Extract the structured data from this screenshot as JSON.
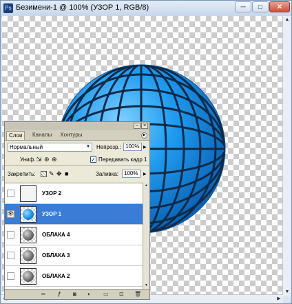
{
  "window": {
    "app_icon": "Ps",
    "title": "Безимени-1 @ 100% (УЗОР 1, RGB/8)",
    "minimize": "─",
    "maximize": "□",
    "close": "✕"
  },
  "canvas": {
    "image": "blue-tiled-sphere"
  },
  "layers_panel": {
    "tabs": [
      "Слои",
      "Каналы",
      "Контуры"
    ],
    "active_tab": "Слои",
    "blend_mode": "Нормальный",
    "opacity_label": "Непрозр.:",
    "opacity_value": "100%",
    "unify_label": "Униф.:",
    "propagate_frame_label": "Передавать кадр 1",
    "propagate_frame_checked": true,
    "lock_label": "Закрепить:",
    "fill_label": "Заливка:",
    "fill_value": "100%",
    "layers": [
      {
        "name": "УЗОР 2",
        "visible": false,
        "selected": false,
        "thumb": "blank"
      },
      {
        "name": "УЗОР 1",
        "visible": true,
        "selected": true,
        "thumb": "blue-sphere"
      },
      {
        "name": "ОБЛАКА 4",
        "visible": false,
        "selected": false,
        "thumb": "gray-sphere"
      },
      {
        "name": "ОБЛАКА 3",
        "visible": false,
        "selected": false,
        "thumb": "gray-sphere"
      },
      {
        "name": "ОБЛАКА 2",
        "visible": false,
        "selected": false,
        "thumb": "gray-sphere"
      }
    ],
    "bottom_icons": [
      "link-icon",
      "layer-style-icon",
      "mask-icon",
      "adjustment-icon",
      "group-icon",
      "new-layer-icon",
      "trash-icon"
    ]
  },
  "colors": {
    "selection": "#3a7cd6",
    "sphere": "#1e9cf0",
    "grid_lines": "#0d2a48"
  }
}
